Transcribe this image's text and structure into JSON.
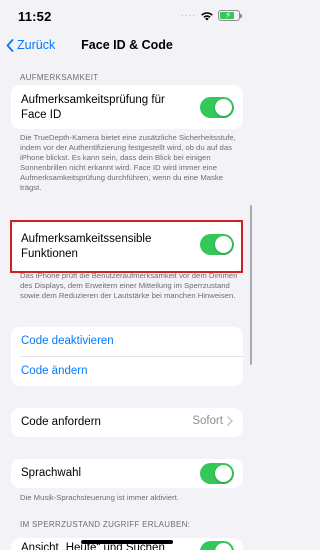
{
  "status_bar": {
    "time": "11:52",
    "signal": "....",
    "icons": [
      "wifi-icon",
      "battery-charging-icon"
    ],
    "battery_level": 0.8
  },
  "nav": {
    "back_label": "Zurück",
    "title": "Face ID & Code"
  },
  "attention": {
    "header": "AUFMERKSAMKEIT",
    "require_attention": {
      "label": "Aufmerksamkeitsprüfung für Face ID",
      "on": true
    },
    "require_attention_footnote": "Die TrueDepth-Kamera bietet eine zusätzliche Sicherheitsstufe, indem vor der Authentifizierung festgestellt wird, ob du auf das iPhone blickst. Es kann sein, dass dein Blick bei einigen Sonnenbrillen nicht erkannt wird. Face ID wird immer eine Aufmerksamkeitsprüfung durchführen, wenn du eine Maske trägst.",
    "aware_features": {
      "label": "Aufmerksamkeitssensible Funktionen",
      "on": true
    },
    "aware_features_footnote": "Das iPhone prüft die Benutzeraufmerksamkeit vor dem Dimmen des Displays, dem Erweitern einer Mitteilung im Sperrzustand sowie dem Reduzieren der Lautstärke bei manchen Hinweisen."
  },
  "passcode": {
    "turn_off": "Code deaktivieren",
    "change": "Code ändern"
  },
  "require_passcode": {
    "label": "Code anfordern",
    "value": "Sofort"
  },
  "voice_dial": {
    "label": "Sprachwahl",
    "on": true,
    "footnote": "Die Musik-Sprachsteuerung ist immer aktiviert."
  },
  "lock_screen": {
    "header": "IM SPERRZUSTAND ZUGRIFF ERLAUBEN:",
    "first_item_label": "Ansicht „Heute“ und Suchen"
  },
  "colors": {
    "accent": "#007aff",
    "toggle_on": "#34c759",
    "highlight": "#d0201f",
    "background": "#f2f2f7"
  }
}
